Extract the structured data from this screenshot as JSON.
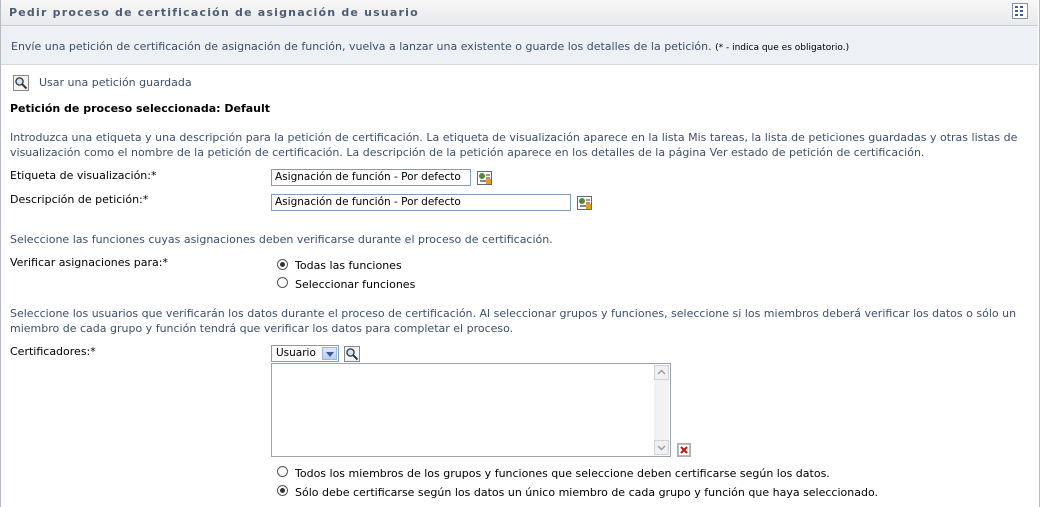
{
  "header": {
    "title": "Pedir proceso de certificación de asignación de usuario",
    "icon": "grid-menu-icon"
  },
  "info": {
    "text": "Envíe una petición de certificación de asignación de función, vuelva a lanzar una existente o guarde los detalles de la petición.",
    "note": "(* - indica que es obligatorio.)"
  },
  "saved_request": {
    "icon": "magnifier-icon",
    "label": "Usar una petición guardada"
  },
  "selected_process": {
    "label": "Petición de proceso seleccionada: Default"
  },
  "intro": {
    "text": "Introduzca una etiqueta y una descripción para la petición de certificación. La etiqueta de visualización aparece en la lista Mis tareas, la lista de peticiones guardadas y otras listas de visualización como el nombre de la petición de certificación. La descripción de la petición aparece en los detalles de la página Ver estado de petición de certificación."
  },
  "display_label": {
    "label": "Etiqueta de visualización:*",
    "value": "Asignación de función - Por defecto",
    "icon": "edit-localized-icon"
  },
  "description": {
    "label": "Descripción de petición:*",
    "value": "Asignación de función - Por defecto",
    "icon": "edit-localized-icon"
  },
  "roles_section": {
    "text": "Seleccione las funciones cuyas asignaciones deben verificarse durante el proceso de certificación."
  },
  "verify": {
    "label": "Verificar asignaciones para:*",
    "option_all": "Todas las funciones",
    "option_select": "Seleccionar funciones",
    "selected": "Todas las funciones"
  },
  "users_section": {
    "text": "Seleccione los usuarios que verificarán los datos durante el proceso de certificación. Al seleccionar grupos y funciones, seleccione si los miembros deberá verificar los datos o sólo un miembro de cada grupo y función tendrá que verificar los datos para completar el proceso."
  },
  "certifiers": {
    "label": "Certificadores:*",
    "type_value": "Usuario",
    "search_icon": "magnifier-icon",
    "remove_icon": "delete-x-icon"
  },
  "members": {
    "option_all": "Todos los miembros de los grupos y funciones que seleccione deben certificarse según los datos.",
    "option_one": "Sólo debe certificarse según los datos un único miembro de cada grupo y función que haya seleccionado.",
    "selected": "option_one"
  },
  "colors": {
    "header_text": "#4d5d74",
    "body_text": "#3c4f6b",
    "info_bg": "#edf0f4"
  }
}
